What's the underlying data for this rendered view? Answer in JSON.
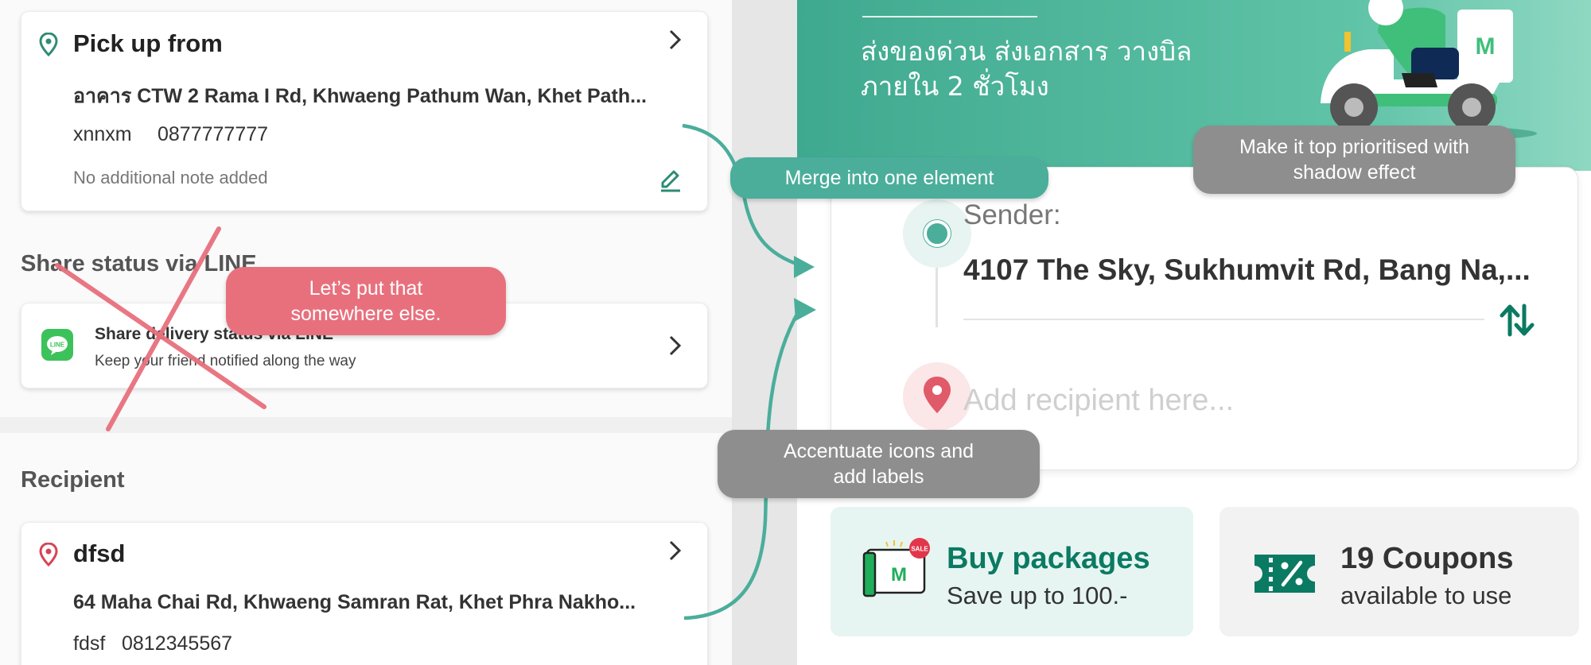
{
  "left_panel": {
    "pickup": {
      "title": "Pick up from",
      "address": "อาคาร CTW 2 Rama I Rd, Khwaeng Pathum Wan, Khet Path...",
      "contact_name": "xnnxm",
      "contact_phone": "0877777777",
      "note": "No additional note added"
    },
    "share_section": {
      "heading": "Share status via LINE",
      "item_label": "Share delivery status via LINE",
      "item_sub": "Keep your friend notified along the way",
      "line_badge": "LINE"
    },
    "recipient_section": {
      "heading": "Recipient",
      "name": "dfsd",
      "address": "64 Maha Chai Rd, Khwaeng Samran Rat, Khet Phra Nakho...",
      "contact_name": "fdsf",
      "contact_phone": "0812345567"
    }
  },
  "right_panel": {
    "hero": {
      "line1": "ส่งของด่วน ส่งเอกสาร วางบิล",
      "line2": "ภายใน 2 ชั่วโมง",
      "logo_letter": "M"
    },
    "route": {
      "sender_label": "Sender:",
      "sender_address": "4107 The Sky, Sukhumvit Rd, Bang Na,...",
      "recipient_placeholder": "Add recipient here..."
    },
    "promos": {
      "buy": {
        "title": "Buy packages",
        "subtitle": "Save up to 100.-",
        "sale_badge": "SALE",
        "logo_letter": "M"
      },
      "coupons": {
        "title": "19 Coupons",
        "subtitle": "available to use"
      }
    }
  },
  "annotations": {
    "merge": "Merge into one element",
    "move_line": [
      "Let’s put that",
      "somewhere else."
    ],
    "shadow": [
      "Make it top prioritised with",
      "shadow effect"
    ],
    "icons": [
      "Accentuate icons and",
      "add labels"
    ]
  },
  "colors": {
    "brand_green": "#3fa98f",
    "dark_green": "#0b7a63",
    "annotation_teal": "#4aae9b",
    "annotation_red": "#e8707d",
    "annotation_gray": "#8e8e8e",
    "pin_red": "#e05a6a"
  },
  "icons": {
    "pickup_pin": "location-pin-icon",
    "recipient_pin": "location-pin-icon",
    "edit": "pencil-edit-icon",
    "chevron": "chevron-right-icon",
    "swap": "swap-vertical-icon",
    "coupon": "coupon-percent-icon",
    "package": "package-box-icon"
  }
}
